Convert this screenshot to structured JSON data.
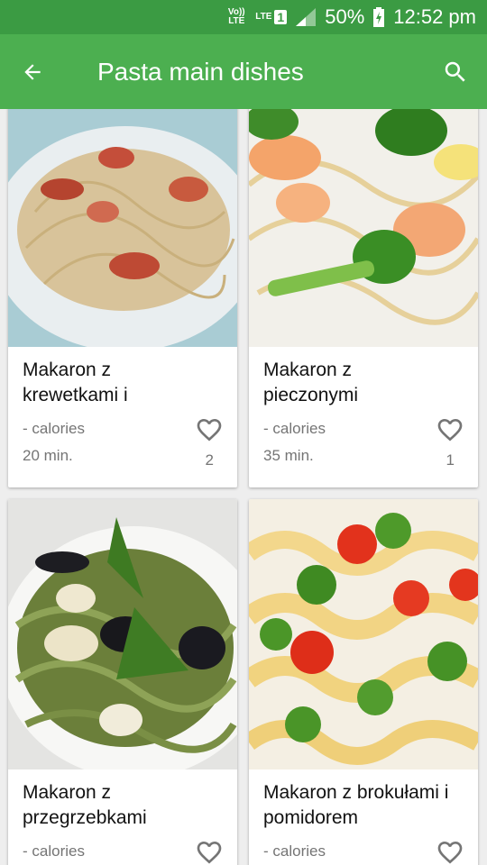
{
  "status": {
    "volte": "Vo)) LTE",
    "lte": "LTE",
    "sim": "1",
    "battery": "50%",
    "time": "12:52 pm"
  },
  "appbar": {
    "title": "Pasta main dishes",
    "back_icon": "arrow-back-icon",
    "search_icon": "search-icon"
  },
  "colors": {
    "status_bar": "#3b9b43",
    "app_bar": "#4caf50"
  },
  "recipes": [
    {
      "name": "Makaron z krewetkami i",
      "calories": "- calories",
      "time": "20 min.",
      "likes": "2"
    },
    {
      "name": "Makaron z pieczonymi",
      "calories": "- calories",
      "time": "35 min.",
      "likes": "1"
    },
    {
      "name": "Makaron z przegrzebkami",
      "calories": "- calories",
      "time": "",
      "likes": ""
    },
    {
      "name": "Makaron z brokułami i pomidorem",
      "calories": "- calories",
      "time": "",
      "likes": ""
    }
  ]
}
